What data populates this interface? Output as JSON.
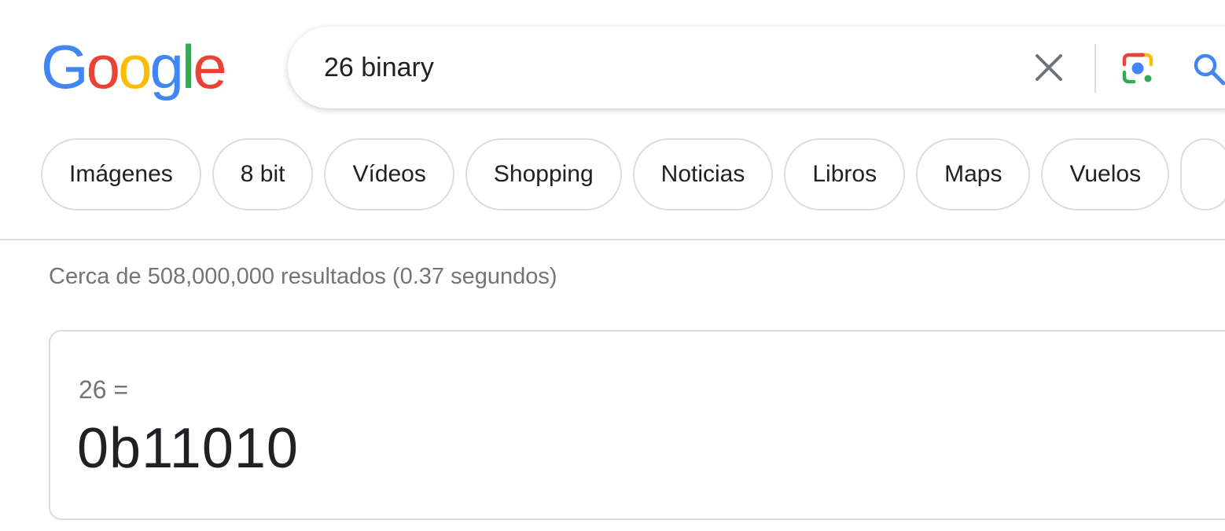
{
  "logo": {
    "letters": [
      "G",
      "o",
      "o",
      "g",
      "l",
      "e"
    ],
    "colors": [
      "#4285F4",
      "#EA4335",
      "#FBBC05",
      "#4285F4",
      "#34A853",
      "#EA4335"
    ]
  },
  "search": {
    "query": "26 binary",
    "clear_icon": "close-icon",
    "lens_icon": "camera-lens-icon",
    "search_icon": "search-icon"
  },
  "chips": [
    "Imágenes",
    "8 bit",
    "Vídeos",
    "Shopping",
    "Noticias",
    "Libros",
    "Maps",
    "Vuelos"
  ],
  "results": {
    "stats": "Cerca de 508,000,000 resultados (0.37 segundos)"
  },
  "calculator": {
    "expression": "26 =",
    "result": "0b11010"
  },
  "colors": {
    "blue": "#4285F4",
    "red": "#EA4335",
    "yellow": "#FBBC05",
    "green": "#34A853",
    "icon_gray": "#70757a",
    "search_blue": "#4285F4"
  }
}
